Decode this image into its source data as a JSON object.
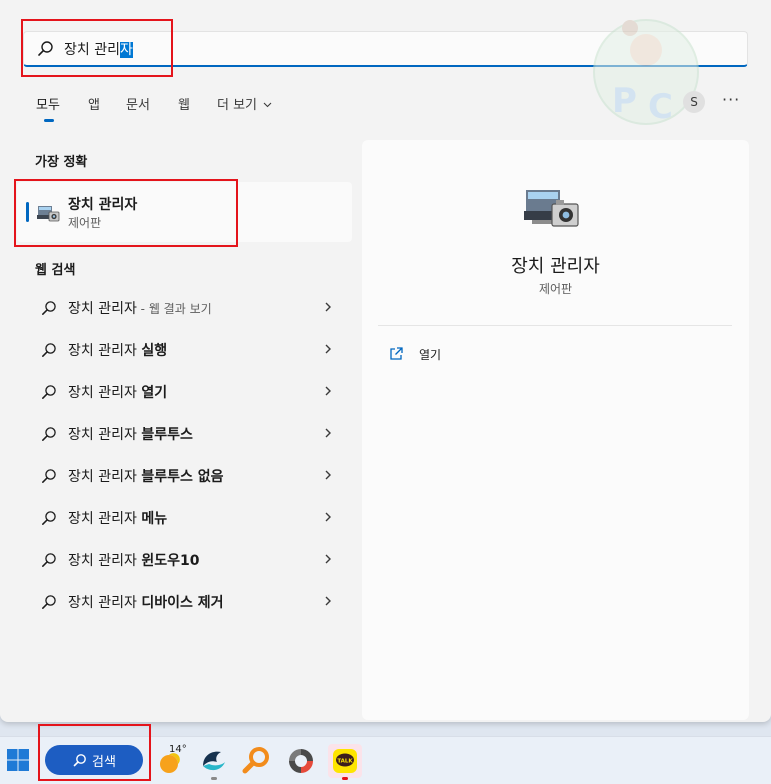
{
  "search": {
    "query_prefix": "장치 관리",
    "query_selected": "자"
  },
  "tabs": [
    {
      "label": "모두"
    },
    {
      "label": "앱"
    },
    {
      "label": "문서"
    },
    {
      "label": "웹"
    },
    {
      "label": "더 보기"
    }
  ],
  "account": {
    "initial": "S"
  },
  "more_label": "···",
  "sections": {
    "best_match_title": "가장 정확",
    "web_search_title": "웹 검색"
  },
  "best_match": {
    "title": "장치 관리자",
    "subtitle": "제어판"
  },
  "web_results": [
    {
      "base": "장치 관리자",
      "bold": "",
      "suffix": " - 웹 결과 보기"
    },
    {
      "base": "장치 관리자 ",
      "bold": "실행",
      "suffix": ""
    },
    {
      "base": "장치 관리자 ",
      "bold": "열기",
      "suffix": ""
    },
    {
      "base": "장치 관리자 ",
      "bold": "블루투스",
      "suffix": ""
    },
    {
      "base": "장치 관리자 ",
      "bold": "블루투스 없음",
      "suffix": ""
    },
    {
      "base": "장치 관리자 ",
      "bold": "메뉴",
      "suffix": ""
    },
    {
      "base": "장치 관리자 ",
      "bold": "윈도우10",
      "suffix": ""
    },
    {
      "base": "장치 관리자 ",
      "bold": "디바이스 제거",
      "suffix": ""
    }
  ],
  "detail": {
    "name": "장치 관리자",
    "category": "제어판",
    "open_label": "열기"
  },
  "taskbar": {
    "search_label": "검색",
    "weather_temp": "14°",
    "kakao_label": "TALK"
  },
  "colors": {
    "accent": "#0067c0",
    "highlight_box": "#e4141b",
    "taskbar_search": "#1d5dc2"
  }
}
